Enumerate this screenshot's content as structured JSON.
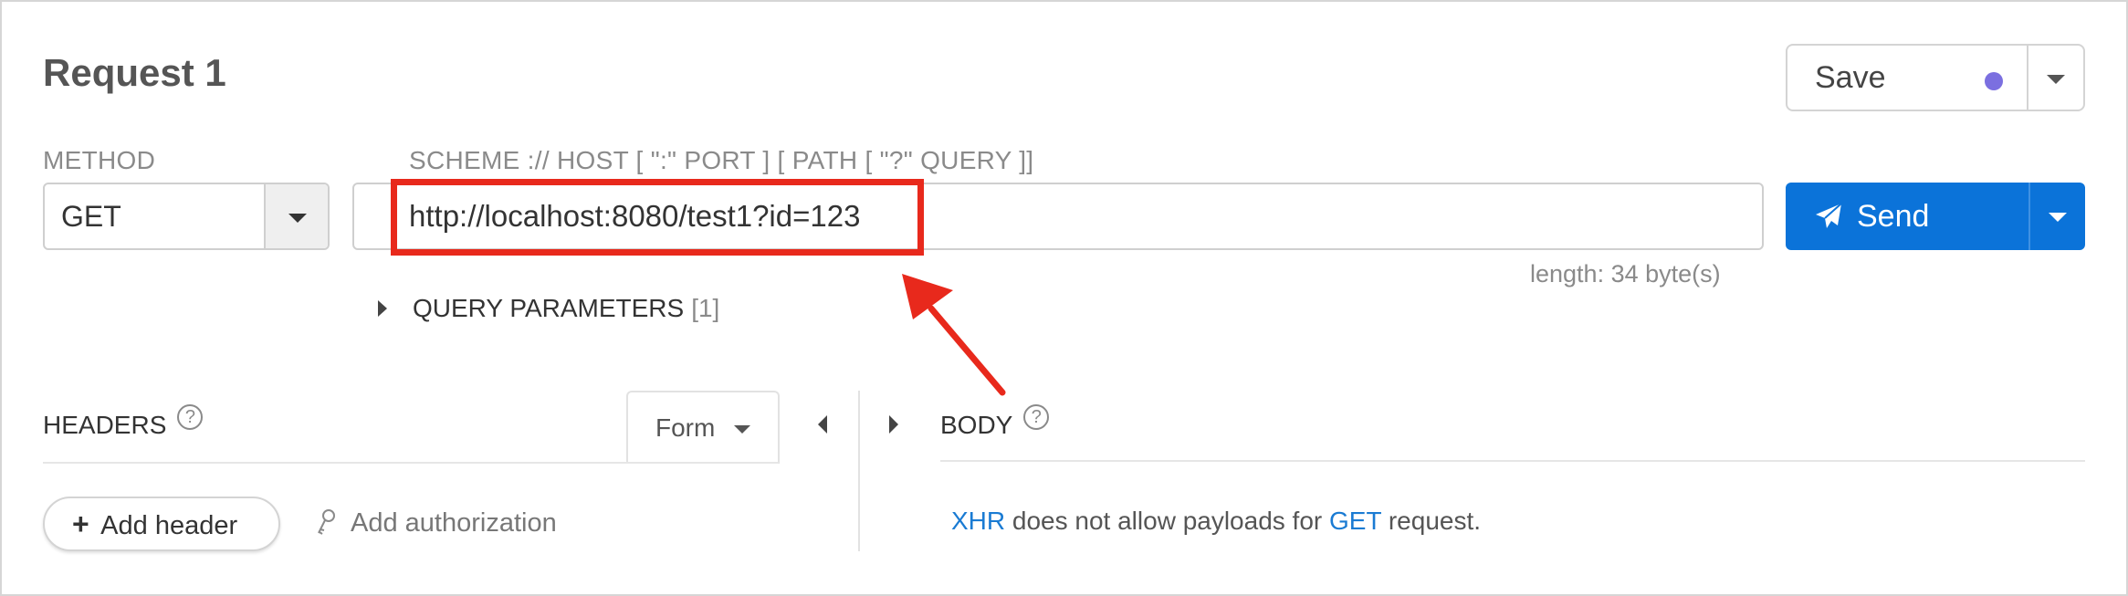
{
  "request": {
    "title": "Request 1"
  },
  "save": {
    "label": "Save",
    "status_dot_color": "#7b6fe0"
  },
  "method": {
    "label": "METHOD",
    "value": "GET"
  },
  "url": {
    "label": "SCHEME :// HOST [ \":\" PORT ] [ PATH [ \"?\" QUERY ]]",
    "value": "http://localhost:8080/test1?id=123",
    "length_text": "length: 34 byte(s)",
    "highlight_color": "#e8291c"
  },
  "send": {
    "label": "Send",
    "color": "#0b73d9"
  },
  "query_params": {
    "label": "QUERY PARAMETERS",
    "count": "[1]"
  },
  "headers": {
    "title": "HEADERS",
    "help": "?",
    "mode": "Form",
    "add_header_label": "Add header",
    "add_authorization_label": "Add authorization"
  },
  "body": {
    "title": "BODY",
    "help": "?",
    "message_prefix": "XHR",
    "message_middle": " does not allow payloads for ",
    "message_method": "GET",
    "message_suffix": " request."
  },
  "icons": {
    "save_dot": "status-dot-icon",
    "send": "paper-plane-icon",
    "key": "key-icon",
    "help": "help-circle-icon",
    "expand": "triangle-right-icon"
  }
}
